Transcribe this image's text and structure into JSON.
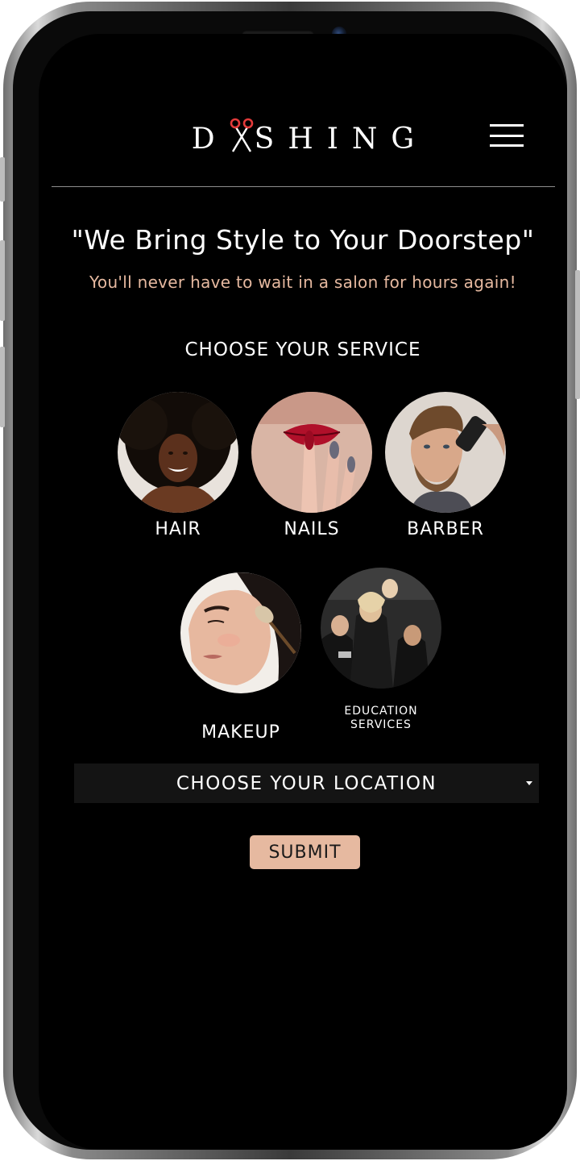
{
  "header": {
    "logo_text_before": "D",
    "logo_text_after": "SHING",
    "logo_icon": "scissors-icon",
    "menu_icon": "hamburger-menu-icon"
  },
  "hero": {
    "headline": "\"We Bring Style to Your Doorstep\"",
    "subline": "You'll never have to wait in a salon for hours again!"
  },
  "services": {
    "title": "CHOOSE YOUR SERVICE",
    "items": [
      {
        "label": "HAIR"
      },
      {
        "label": "NAILS"
      },
      {
        "label": "BARBER"
      },
      {
        "label": "MAKEUP"
      },
      {
        "label_line1": "EDUCATION",
        "label_line2": "SERVICES"
      }
    ]
  },
  "location": {
    "label": "CHOOSE YOUR LOCATION",
    "icon": "caret-down-icon"
  },
  "form": {
    "submit_label": "SUBMIT"
  },
  "colors": {
    "background": "#000000",
    "accent": "#e6b9a0",
    "logo_scissor_red": "#e23a3a",
    "select_bg": "#141414"
  }
}
